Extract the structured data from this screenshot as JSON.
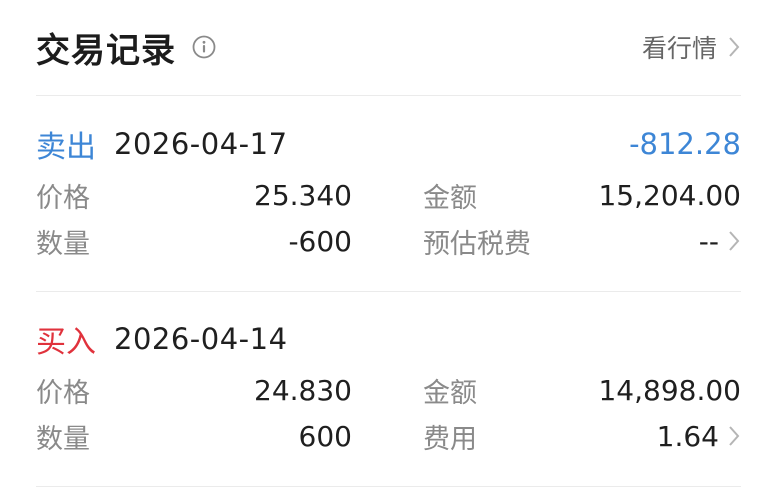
{
  "header": {
    "title": "交易记录",
    "market_link": "看行情"
  },
  "trades": [
    {
      "type": "卖出",
      "type_color": "#3d86d6",
      "date": "2026-04-17",
      "pnl": "-812.28",
      "pnl_color": "#3d86d6",
      "price_label": "价格",
      "price": "25.340",
      "amount_label": "金额",
      "amount": "15,204.00",
      "qty_label": "数量",
      "qty": "-600",
      "fee_label": "预估税费",
      "fee": "--"
    },
    {
      "type": "买入",
      "type_color": "#e0323c",
      "date": "2026-04-14",
      "pnl": "",
      "pnl_color": "#1f1f1f",
      "price_label": "价格",
      "price": "24.830",
      "amount_label": "金额",
      "amount": "14,898.00",
      "qty_label": "数量",
      "qty": "600",
      "fee_label": "费用",
      "fee": "1.64"
    }
  ],
  "icons": {
    "info": "info-circle-icon",
    "chevron": "chevron-right-icon"
  }
}
